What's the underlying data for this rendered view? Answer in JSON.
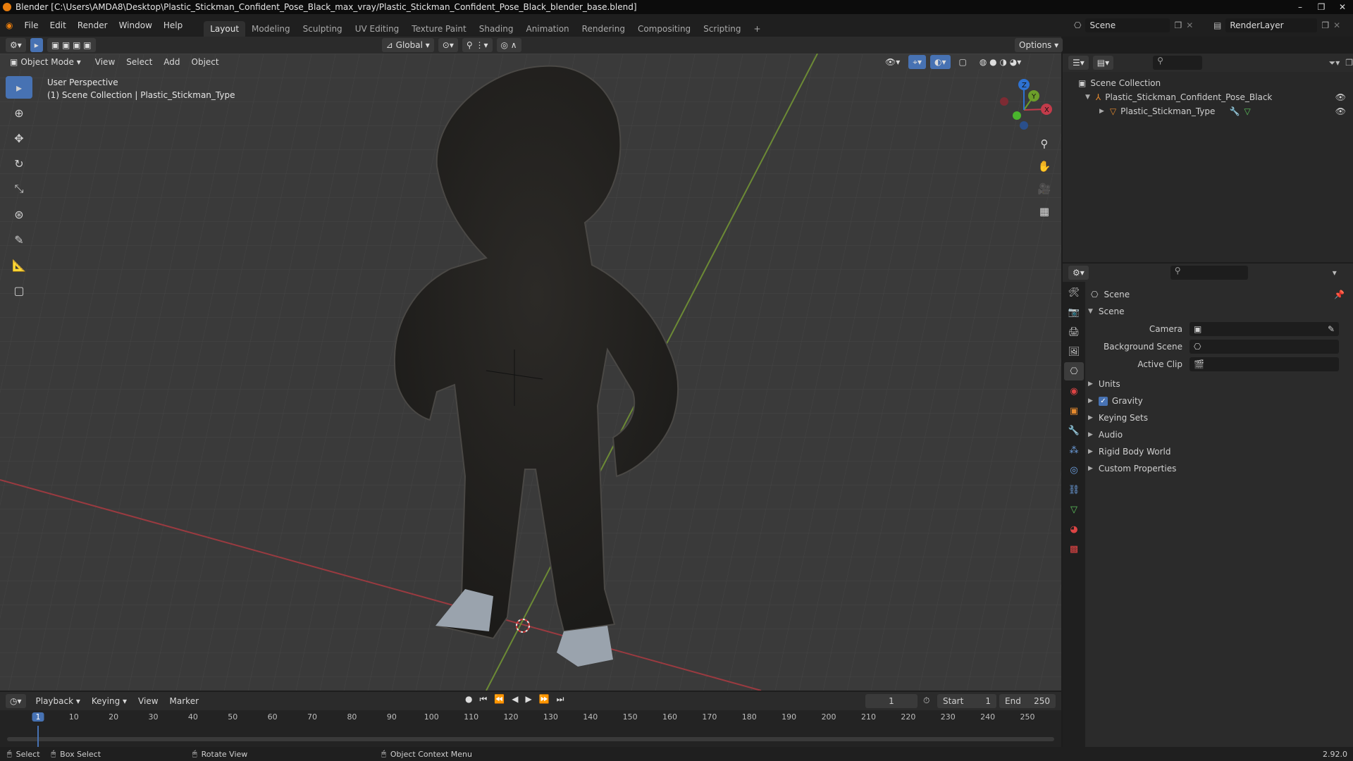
{
  "window": {
    "title": "Blender [C:\\Users\\AMDA8\\Desktop\\Plastic_Stickman_Confident_Pose_Black_max_vray/Plastic_Stickman_Confident_Pose_Black_blender_base.blend]",
    "controls": [
      "–",
      "❐",
      "✕"
    ]
  },
  "menu": {
    "items": [
      "File",
      "Edit",
      "Render",
      "Window",
      "Help"
    ],
    "workspaces": [
      "Layout",
      "Modeling",
      "Sculpting",
      "UV Editing",
      "Texture Paint",
      "Shading",
      "Animation",
      "Rendering",
      "Compositing",
      "Scripting"
    ],
    "active_workspace": "Layout",
    "add_tab": "+",
    "scene": "Scene",
    "render_layer": "RenderLayer"
  },
  "viewport_header": {
    "transform_orientation": "Global",
    "options": "Options",
    "mode": "Object Mode",
    "menus": [
      "View",
      "Select",
      "Add",
      "Object"
    ]
  },
  "viewport": {
    "perspective": "User Perspective",
    "collection_info": "(1) Scene Collection | Plastic_Stickman_Type",
    "gizmo_axes": [
      "X",
      "Y",
      "Z"
    ],
    "colors": {
      "x_axis": "#c33b4a",
      "y_axis": "#6c9e2a",
      "z_axis": "#2e72d2",
      "active_tool": "#4772b3"
    }
  },
  "outliner": {
    "root": "Scene Collection",
    "items": [
      {
        "label": "Plastic_Stickman_Confident_Pose_Black",
        "level": 1
      },
      {
        "label": "Plastic_Stickman_Type",
        "level": 2
      }
    ]
  },
  "properties": {
    "context": "Scene",
    "panel": "Scene",
    "fields": [
      {
        "label": "Camera",
        "value": ""
      },
      {
        "label": "Background Scene",
        "value": ""
      },
      {
        "label": "Active Clip",
        "value": ""
      }
    ],
    "subpanels": [
      "Units",
      "Gravity",
      "Keying Sets",
      "Audio",
      "Rigid Body World",
      "Custom Properties"
    ],
    "gravity_checked": true
  },
  "timeline": {
    "menus": [
      "Playback",
      "Keying",
      "View",
      "Marker"
    ],
    "current_frame": "1",
    "start_label": "Start",
    "start": "1",
    "end_label": "End",
    "end": "250",
    "ruler": [
      "1",
      "10",
      "20",
      "30",
      "40",
      "50",
      "60",
      "70",
      "80",
      "90",
      "100",
      "110",
      "120",
      "130",
      "140",
      "150",
      "160",
      "170",
      "180",
      "190",
      "200",
      "210",
      "220",
      "230",
      "240",
      "250"
    ]
  },
  "status": {
    "select": "Select",
    "box_select": "Box Select",
    "rotate_view": "Rotate View",
    "context_menu": "Object Context Menu",
    "version": "2.92.0"
  }
}
